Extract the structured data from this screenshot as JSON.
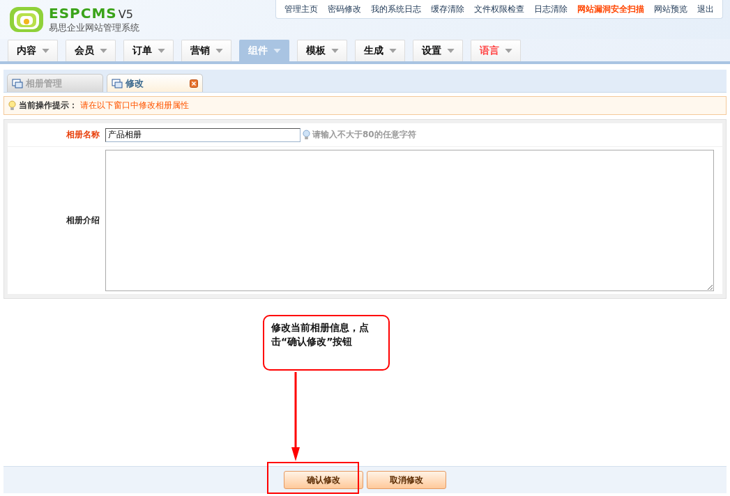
{
  "logo": {
    "brand": "ESPCMS",
    "version": "V5",
    "subtitle": "易思企业网站管理系统"
  },
  "top_links": [
    {
      "label": "管理主页",
      "highlight": false
    },
    {
      "label": "密码修改",
      "highlight": false
    },
    {
      "label": "我的系统日志",
      "highlight": false
    },
    {
      "label": "缓存清除",
      "highlight": false
    },
    {
      "label": "文件权限检查",
      "highlight": false
    },
    {
      "label": "日志清除",
      "highlight": false
    },
    {
      "label": "网站漏洞安全扫描",
      "highlight": true
    },
    {
      "label": "网站预览",
      "highlight": false
    },
    {
      "label": "退出",
      "highlight": false
    }
  ],
  "menu": [
    {
      "label": "内容",
      "selected": false,
      "highlight": false
    },
    {
      "label": "会员",
      "selected": false,
      "highlight": false
    },
    {
      "label": "订单",
      "selected": false,
      "highlight": false
    },
    {
      "label": "营销",
      "selected": false,
      "highlight": false
    },
    {
      "label": "组件",
      "selected": true,
      "highlight": false
    },
    {
      "label": "模板",
      "selected": false,
      "highlight": false
    },
    {
      "label": "生成",
      "selected": false,
      "highlight": false
    },
    {
      "label": "设置",
      "selected": false,
      "highlight": false
    },
    {
      "label": "语言",
      "selected": false,
      "highlight": true
    }
  ],
  "tabs": [
    {
      "label": "相册管理",
      "selected": false,
      "closable": false
    },
    {
      "label": "修改",
      "selected": true,
      "closable": true
    }
  ],
  "tip": {
    "label": "当前操作提示：",
    "text": "请在以下窗口中修改相册属性"
  },
  "form": {
    "name_label": "相册名称",
    "name_value": "产品相册",
    "name_hint": "请输入不大于80的任意字符",
    "intro_label": "相册介绍"
  },
  "callout": "修改当前相册信息，点击“确认修改”按钮",
  "buttons": [
    {
      "label": "确认修改"
    },
    {
      "label": "取消修改"
    }
  ]
}
